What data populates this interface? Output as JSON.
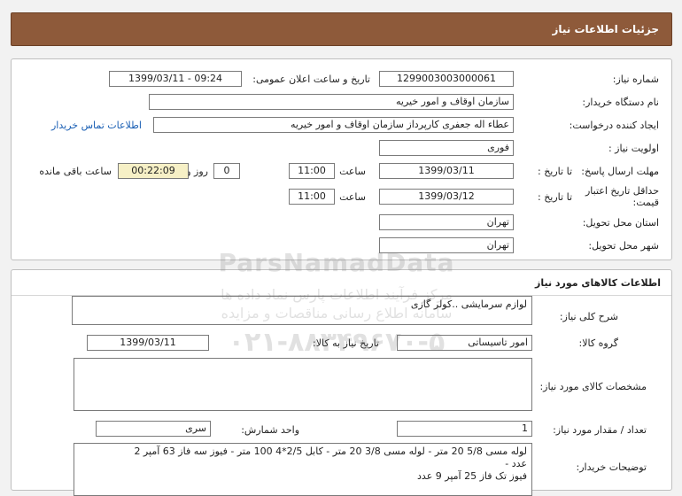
{
  "header": {
    "title": "جزئیات اطلاعات نیاز"
  },
  "details": {
    "need_number_label": "شماره نیاز:",
    "need_number": "1299003003000061",
    "announce_label": "تاریخ و ساعت اعلان عمومی:",
    "announce_value": "1399/03/11 - 09:24",
    "buyer_org_label": "نام دستگاه خریدار:",
    "buyer_org": "سازمان اوقاف و امور خیریه",
    "requester_label": "ایجاد کننده درخواست:",
    "requester": "عطاء اله جعفری کارپرداز سازمان اوقاف و امور خیریه",
    "contact_link": "اطلاعات تماس خریدار",
    "priority_label": "اولویت نیاز :",
    "priority": "فوری",
    "deadline_label": "مهلت ارسال پاسخ:",
    "to_date_label": "تا تاریخ :",
    "deadline_date": "1399/03/11",
    "time_label": "ساعت",
    "deadline_time": "11:00",
    "days_value": "0",
    "days_label": "روز و",
    "remaining_time": "00:22:09",
    "remaining_label": "ساعت باقی مانده",
    "validity_label": "حداقل تاریخ اعتبار قیمت:",
    "validity_to_label": "تا تاریخ :",
    "validity_date": "1399/03/12",
    "validity_time_label": "ساعت",
    "validity_time": "11:00",
    "province_label": "استان محل تحویل:",
    "province": "تهران",
    "city_label": "شهر محل تحویل:",
    "city": "تهران"
  },
  "goods": {
    "section_title": "اطلاعات کالاهای مورد نیاز",
    "description_label": "شرح کلی نیاز:",
    "description": "لوازم سرمایشی ..کولر گازی",
    "group_label": "گروه کالا:",
    "group": "امور تاسیساتی",
    "need_date_label": "تاریخ نیاز به کالا:",
    "need_date": "1399/03/11",
    "specs_label": "مشخصات کالای مورد نیاز:",
    "specs": "",
    "qty_label": "تعداد / مقدار مورد نیاز:",
    "qty": "1",
    "unit_label": "واحد شمارش:",
    "unit": "سری",
    "buyer_notes_label": "توضیحات خریدار:",
    "buyer_notes_line1": "لوله مسی 5/8   20 متر - لوله مسی 3/8   20 متر - کابل 2/5*4   100 متر - فیوز سه فاز 63 آمپر   2",
    "buyer_notes_line2": "عدد -",
    "buyer_notes_line3": "فیوز تک فاز 25 آمپر   9 عدد"
  },
  "watermark": {
    "brand": "ParsNamadData",
    "line1": "مرکز فرآیند اطلاعات پارس نماد داده ها",
    "line2": "سامانه اطلاع رسانی مناقصات و مزایده",
    "phone": "۰۲۱-۸۸۳۴۹۶۷۰-۵"
  }
}
